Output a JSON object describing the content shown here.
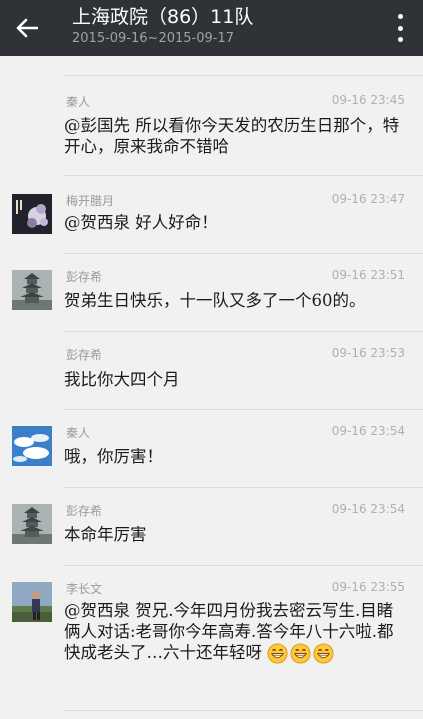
{
  "header": {
    "title": "上海政院（86）11队",
    "subtitle": "2015-09-16~2015-09-17"
  },
  "messages": [
    {
      "sender": "秦人",
      "time": "09-16 23:45",
      "text": "@彭国先 所以看你今天发的农历生日那个，特开心，原来我命不错哈",
      "avatar": "none"
    },
    {
      "sender": "梅开腊月",
      "time": "09-16 23:47",
      "text": "@贺西泉 好人好命！",
      "avatar": "flower-photo"
    },
    {
      "sender": "彭存希",
      "time": "09-16 23:51",
      "text": "贺弟生日快乐，十一队又多了一个60的。",
      "avatar": "pagoda-photo"
    },
    {
      "sender": "彭存希",
      "time": "09-16 23:53",
      "text": "我比你大四个月",
      "avatar": "none"
    },
    {
      "sender": "秦人",
      "time": "09-16 23:54",
      "text": "哦，你厉害！",
      "avatar": "sky-photo"
    },
    {
      "sender": "彭存希",
      "time": "09-16 23:54",
      "text": "本命年厉害",
      "avatar": "pagoda-photo"
    },
    {
      "sender": "李长文",
      "time": "09-16 23:55",
      "text": "@贺西泉 贺兄.今年四月份我去密云写生.目睹俩人对话:老哥你今年高寿.答今年八十六啦.都快成老头了…六十还年轻呀",
      "avatar": "person-photo",
      "emoji": [
        "grin-emoji",
        "grin-emoji",
        "grin-emoji"
      ]
    }
  ],
  "colors": {
    "topbar": "#2f3237",
    "background": "#f1f1f1",
    "meta_text": "#9a9a9a",
    "body_text": "#1a1a1a"
  }
}
